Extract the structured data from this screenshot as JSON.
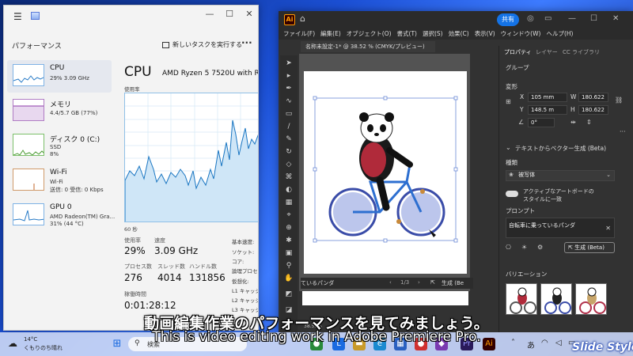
{
  "task_manager": {
    "section_title": "パフォーマンス",
    "new_task_label": "新しいタスクを実行する",
    "resources": [
      {
        "name": "CPU",
        "line1": "29% 3.09 GHz",
        "line2": ""
      },
      {
        "name": "メモリ",
        "line1": "4.4/5.7 GB (77%)",
        "line2": ""
      },
      {
        "name": "ディスク 0 (C:)",
        "line1": "SSD",
        "line2": "8%"
      },
      {
        "name": "Wi-Fi",
        "line1": "Wi-Fi",
        "line2": "送信: 0 受信: 0 Kbps"
      },
      {
        "name": "GPU 0",
        "line1": "AMD Radeon(TM) Gra...",
        "line2": "31% (44 °C)"
      }
    ],
    "cpu_title": "CPU",
    "cpu_model": "AMD Ryzen 5 7520U with Ra",
    "usage_label": "使用率",
    "seconds_label": "60 秒",
    "stats": {
      "usage_label": "使用率",
      "usage_value": "29%",
      "speed_label": "速度",
      "speed_value": "3.09 GHz",
      "process_label": "プロセス数",
      "process_value": "276",
      "thread_label": "スレッド数",
      "thread_value": "4014",
      "handle_label": "ハンドル数",
      "handle_value": "131856",
      "uptime_label": "稼働時間",
      "uptime_value": "0:01:28:12"
    },
    "side_labels": [
      "基本速度:",
      "ソケット:",
      "コア:",
      "論理プロセッサ",
      "仮想化:",
      "L1 キャッシュ:",
      "L2 キャッシュ:",
      "L3 キャッシュ:"
    ]
  },
  "illustrator": {
    "share_label": "共有",
    "menu": [
      "ファイル(F)",
      "編集(E)",
      "オブジェクト(O)",
      "書式(T)",
      "選択(S)",
      "効果(C)",
      "表示(V)",
      "ウィンドウ(W)",
      "ヘルプ(H)"
    ],
    "doc_tab": "名称未設定-1* @ 38.52 % (CMYK/プレビュー)",
    "prompt_bar_text": "ているパンダ",
    "prompt_page": "1/3",
    "prompt_generate": "生成 (Be",
    "zoom": "38.52%",
    "panel": {
      "tabs": [
        "プロパティ",
        "レイヤー",
        "CC ライブラリ"
      ],
      "group_label": "グループ",
      "transform_label": "変形",
      "x_label": "X",
      "x_value": "105 mm",
      "y_label": "Y",
      "y_value": "148.5 m",
      "w_label": "W",
      "w_value": "180.622",
      "h_label": "H",
      "h_value": "180.622",
      "angle_value": "0°",
      "text_to_vector": "テキストからベクター生成 (Beta)",
      "type_label": "種類",
      "type_value": "被写体",
      "artboard_match": "アクティブなアートボードの",
      "artboard_match2": "スタイルに一致",
      "prompt_label": "プロンプト",
      "prompt_value": "自転車に乗っているパンダ",
      "generate_label": "生成 (Beta)",
      "variations_label": "バリエーション"
    }
  },
  "subtitles": {
    "jp": "動画編集作業のパフォーマンスを見てみましょう。",
    "en": "This is video editing work in Adobe Premiere Pro."
  },
  "taskbar": {
    "temp": "14°C",
    "weather": "くもりのち晴れ",
    "search": "検索",
    "ime": "あ"
  },
  "brand": "Slide Style"
}
